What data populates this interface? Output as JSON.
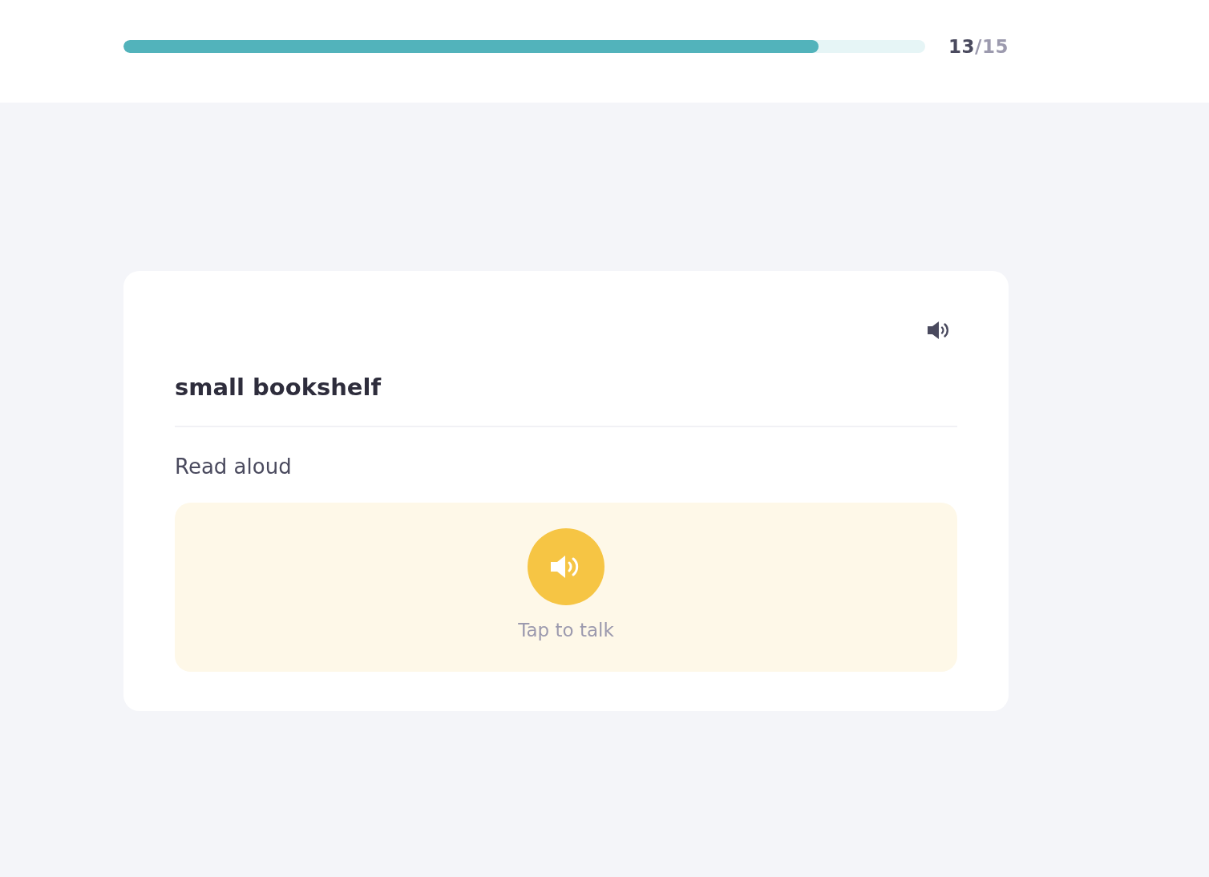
{
  "progress": {
    "level": 0.867,
    "current": "13",
    "rest": "/15"
  },
  "card": {
    "term": "small bookshelf",
    "instruction": "Read aloud",
    "talk_prompt": "Tap to talk"
  }
}
